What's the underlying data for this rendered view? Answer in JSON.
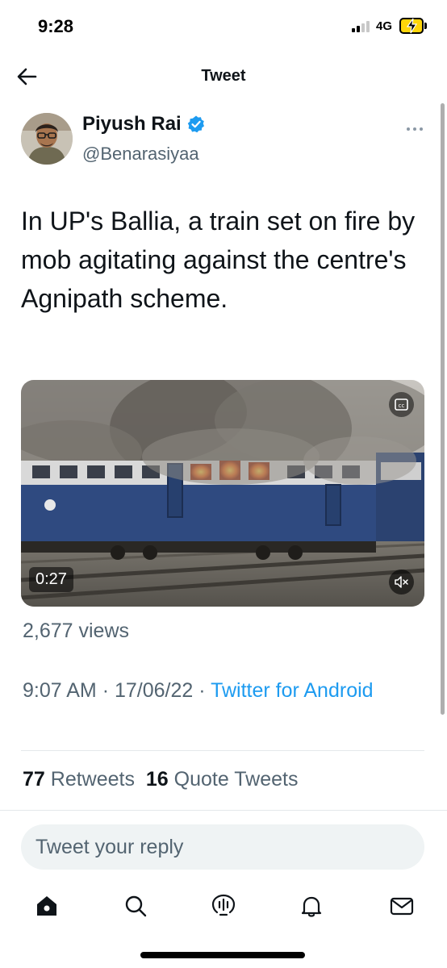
{
  "status_bar": {
    "time": "9:28",
    "network": "4G",
    "signal_bars_filled": 2,
    "signal_bars_total": 4,
    "battery_color": "#ffd60a",
    "charging": true
  },
  "header": {
    "title": "Tweet",
    "back_icon": "arrow-left-icon"
  },
  "tweet": {
    "author": {
      "name": "Piyush Rai",
      "handle": "@Benarasiyaa",
      "verified": true,
      "verified_color": "#1d9bf0"
    },
    "more_icon": "more-dots-icon",
    "text": "In UP's Ballia, a train set on fire by mob agitating against the centre's Agnipath scheme.",
    "media": {
      "type": "video",
      "duration": "0:27",
      "cc_icon": "closed-captions-icon",
      "mute_icon": "speaker-muted-icon"
    },
    "views": "2,677 views",
    "time": "9:07 AM",
    "date": "17/06/22",
    "separator": "·",
    "source": "Twitter for Android",
    "retweets_count": "77",
    "retweets_label": "Retweets",
    "quotes_count": "16",
    "quotes_label": "Quote Tweets"
  },
  "reply": {
    "placeholder": "Tweet your reply"
  },
  "tabbar": {
    "items": [
      "home-icon",
      "search-icon",
      "spaces-icon",
      "notifications-icon",
      "messages-icon"
    ]
  },
  "colors": {
    "accent": "#1d9bf0",
    "text_primary": "#0f1419",
    "text_secondary": "#536471"
  }
}
